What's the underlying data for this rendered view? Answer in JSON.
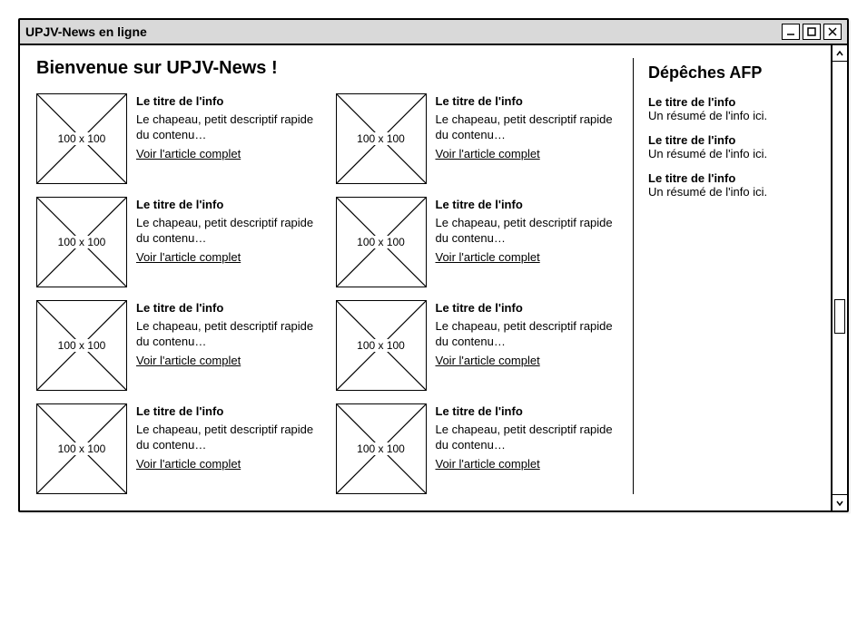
{
  "window": {
    "title": "UPJV-News en ligne"
  },
  "page": {
    "heading": "Bienvenue sur UPJV-News !"
  },
  "thumb_label": "100 x 100",
  "articles": [
    {
      "title": "Le titre de l'info",
      "summary": "Le chapeau, petit descriptif rapide du contenu…",
      "link": "Voir l'article complet"
    },
    {
      "title": "Le titre de l'info",
      "summary": "Le chapeau, petit descriptif rapide du contenu…",
      "link": "Voir l'article complet"
    },
    {
      "title": "Le titre de l'info",
      "summary": "Le chapeau, petit descriptif rapide du contenu…",
      "link": "Voir l'article complet"
    },
    {
      "title": "Le titre de l'info",
      "summary": "Le chapeau, petit descriptif rapide du contenu…",
      "link": "Voir l'article complet"
    },
    {
      "title": "Le titre de l'info",
      "summary": "Le chapeau, petit descriptif rapide du contenu…",
      "link": "Voir l'article complet"
    },
    {
      "title": "Le titre de l'info",
      "summary": "Le chapeau, petit descriptif rapide du contenu…",
      "link": "Voir l'article complet"
    },
    {
      "title": "Le titre de l'info",
      "summary": "Le chapeau, petit descriptif rapide du contenu…",
      "link": "Voir l'article complet"
    },
    {
      "title": "Le titre de l'info",
      "summary": "Le chapeau, petit descriptif rapide du contenu…",
      "link": "Voir l'article complet"
    }
  ],
  "sidebar": {
    "heading": "Dépêches AFP",
    "items": [
      {
        "title": "Le titre de l'info",
        "summary": "Un résumé de l'info ici."
      },
      {
        "title": "Le titre de l'info",
        "summary": "Un résumé de l'info ici."
      },
      {
        "title": "Le titre de l'info",
        "summary": "Un résumé de l'info ici."
      }
    ]
  }
}
